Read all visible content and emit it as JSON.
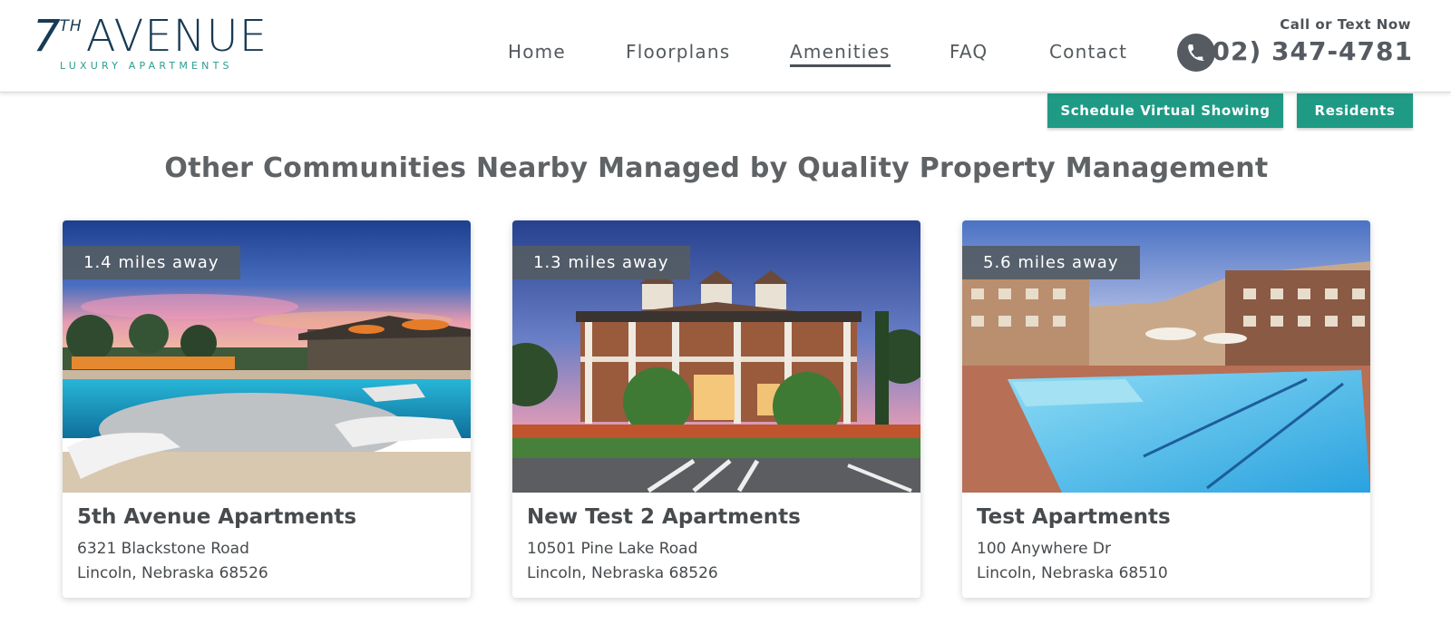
{
  "brand": {
    "logo_number": "7",
    "logo_superscript": "TH",
    "logo_word": "AVENUE",
    "logo_tagline": "LUXURY APARTMENTS",
    "color_navy": "#173b55",
    "color_teal": "#2a9d8f"
  },
  "nav": {
    "items": [
      {
        "label": "Home",
        "active": false
      },
      {
        "label": "Floorplans",
        "active": false
      },
      {
        "label": "Amenities",
        "active": true
      },
      {
        "label": "FAQ",
        "active": false
      },
      {
        "label": "Contact",
        "active": false
      }
    ]
  },
  "contact": {
    "call_label": "Call or Text Now",
    "phone": "(402) 347-4781",
    "icon": "phone-icon"
  },
  "actions": {
    "schedule_label": "Schedule Virtual Showing",
    "residents_label": "Residents",
    "button_color": "#1f9a85"
  },
  "section": {
    "title": "Other Communities Nearby Managed by Quality Property Management"
  },
  "communities": [
    {
      "distance": "1.4 miles away",
      "name": "5th Avenue Apartments",
      "address": "6321 Blackstone Road",
      "city_line": "Lincoln, Nebraska 68526",
      "photo": "pool-sunset"
    },
    {
      "distance": "1.3 miles away",
      "name": "New Test 2 Apartments",
      "address": "10501 Pine Lake Road",
      "city_line": "Lincoln, Nebraska 68526",
      "photo": "clubhouse-porch"
    },
    {
      "distance": "5.6 miles away",
      "name": "Test Apartments",
      "address": "100 Anywhere Dr",
      "city_line": "Lincoln, Nebraska 68510",
      "photo": "pool-courtyard"
    }
  ]
}
